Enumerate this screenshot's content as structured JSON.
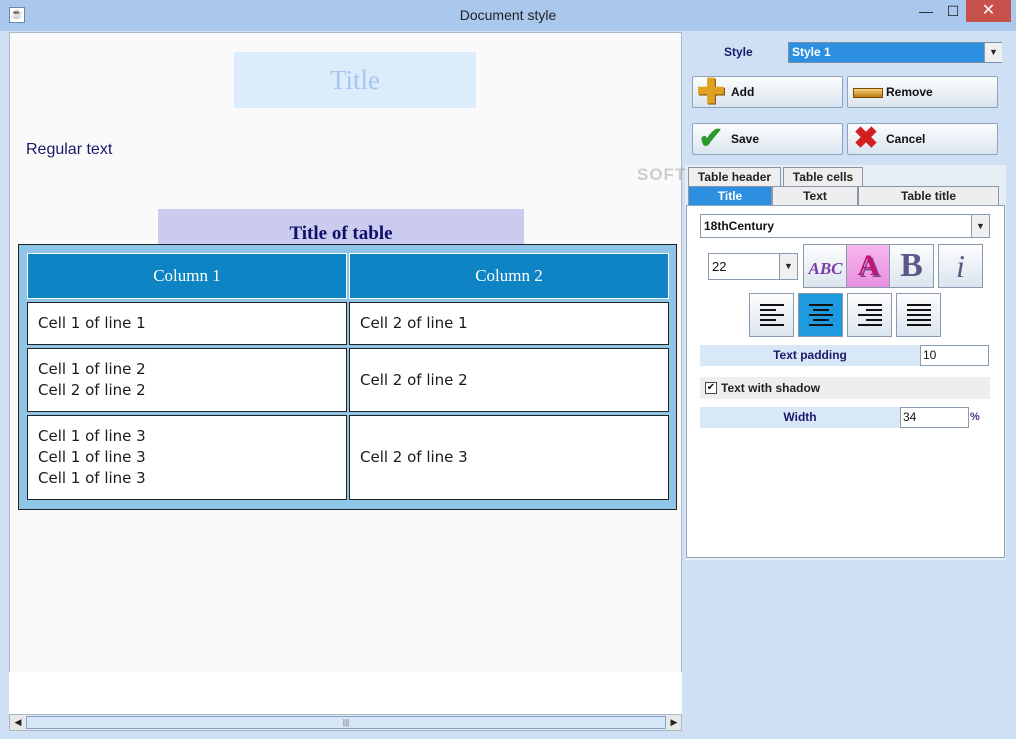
{
  "window": {
    "title": "Document style",
    "icon": "java-cup-icon",
    "min": "—",
    "max": "☐",
    "close": "✕"
  },
  "preview": {
    "title": "Title",
    "regular_text": "Regular text",
    "table_title": "Title of table",
    "columns": [
      "Column 1",
      "Column 2"
    ],
    "rows": [
      {
        "c1": [
          "Cell 1 of line 1"
        ],
        "c2": "Cell 2 of line 1"
      },
      {
        "c1": [
          "Cell 1 of line 2",
          "Cell 2 of line 2"
        ],
        "c2": "Cell 2 of line 2"
      },
      {
        "c1": [
          "Cell 1 of line 3",
          "Cell 1 of line 3",
          "Cell 1 of line 3"
        ],
        "c2": "Cell 2 of line 3"
      }
    ]
  },
  "scrollbar": {
    "left": "◀",
    "right": "▶",
    "thumb": "|||"
  },
  "panel": {
    "style_label": "Style",
    "style_value": "Style 1",
    "dropdown_arrow": "▼",
    "buttons": {
      "add": "Add",
      "remove": "Remove",
      "save": "Save",
      "cancel": "Cancel"
    },
    "tabs_row1": [
      "Table header",
      "Table cells"
    ],
    "tabs_row2": [
      "Title",
      "Text",
      "Table title"
    ],
    "font_name": "18thCentury",
    "font_size": "22",
    "format_buttons": {
      "caps": "ABC",
      "shadow": "A",
      "bold": "B",
      "italic": "i"
    },
    "text_padding_label": "Text padding",
    "text_padding_value": "10",
    "shadow_label": "Text with shadow",
    "shadow_checked": "✔",
    "width_label": "Width",
    "width_value": "34",
    "width_unit": "%"
  },
  "watermark": "SOFT",
  "colors": {
    "header_blue": "#0f84c4",
    "selected_blue": "#2d8fe0",
    "close_red": "#c7504a"
  }
}
